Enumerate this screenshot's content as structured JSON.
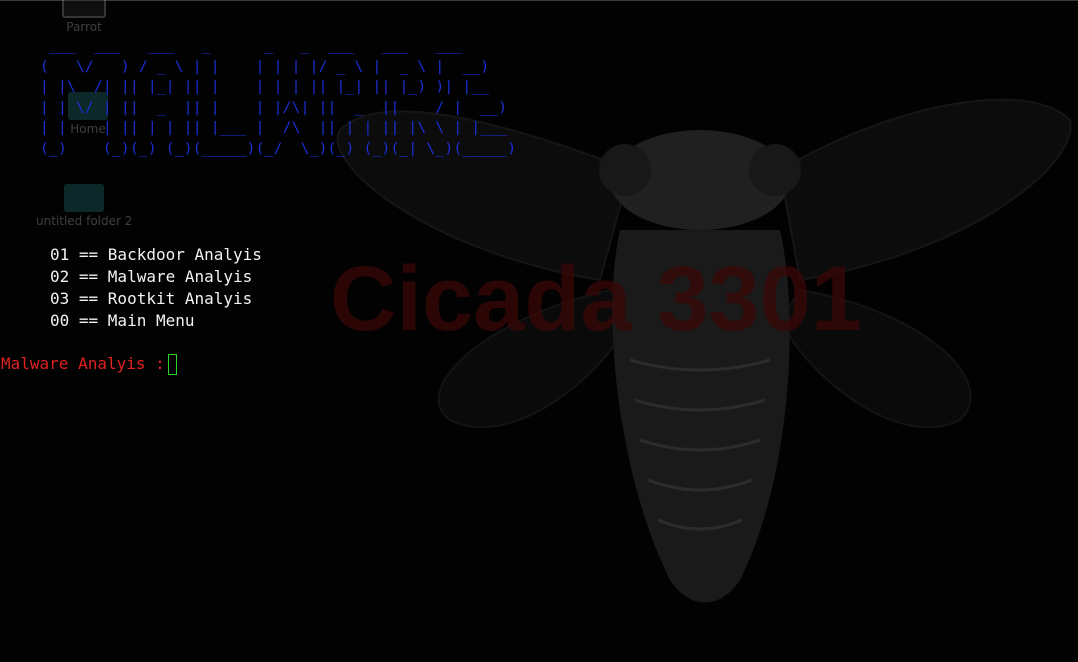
{
  "desktop": {
    "icons": [
      {
        "label": "Parrot",
        "icon": "computer-icon"
      },
      {
        "label": "Home",
        "icon": "home-folder-icon"
      },
      {
        "label": "untitled folder 2",
        "icon": "folder-icon"
      }
    ],
    "wallpaper": {
      "text": "Cicada 3301",
      "icon": "cicada-icon"
    }
  },
  "terminal": {
    "banner_lines": [
      " ___  ___   ___   _      _   _  ___   ___   ___",
      "(   \\/   ) / _ \\ | |    | | | |/ _ \\ |  _ \\ |  __)",
      "| |\\  /| || |_| || |    | | | || |_| || |_) )| |__",
      "| | \\/ | ||  _  || |    | |/\\| ||  _  ||    / |  __)",
      "| |    | || | | || |___ |  /\\  || | | || |\\ \\ | |___",
      "(_)    (_)(_) (_)(_____)(_/  \\_)(_) (_)(_| \\_)(_____)"
    ],
    "menu": [
      "01 == Backdoor Analyis",
      "02 == Malware Analyis",
      "03 == Rootkit Analyis",
      "00 == Main Menu"
    ],
    "prompt": "Malware Analyis :",
    "colors": {
      "banner": "#1b2fd6",
      "prompt": "#e02121",
      "text": "#f2f2f2",
      "cursor": "#29d829"
    }
  }
}
